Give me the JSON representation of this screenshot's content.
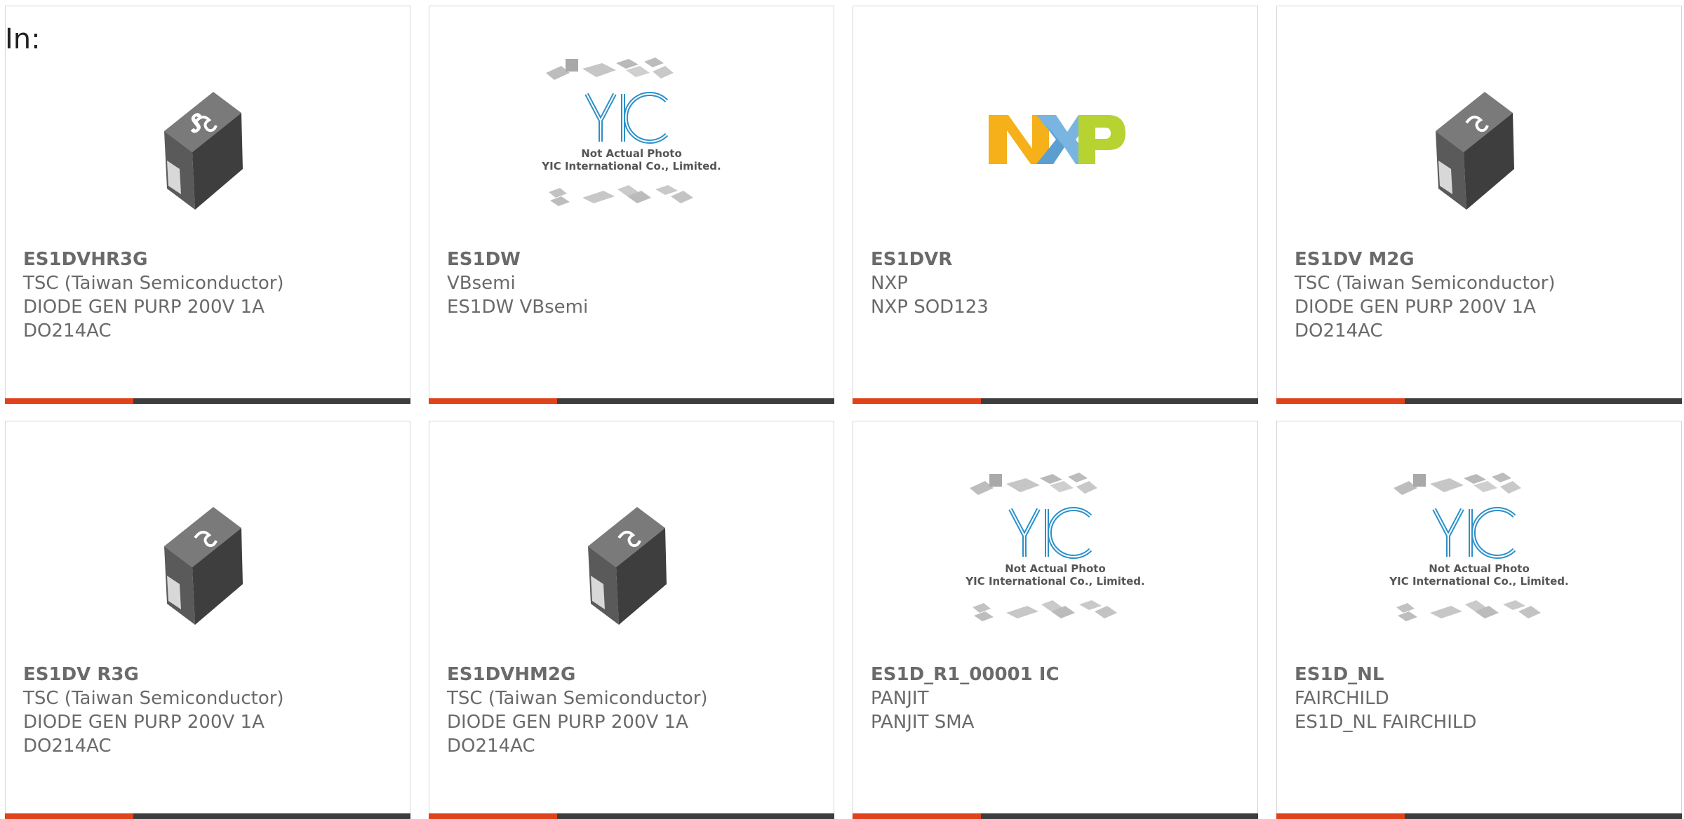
{
  "header": {
    "label": "In:"
  },
  "colors": {
    "accent": "#e0421b",
    "bar": "#3d3d3d",
    "text": "#6a6a6a",
    "border": "#d6d6d6"
  },
  "cards": [
    {
      "part": "ES1DVHR3G",
      "maker": "TSC (Taiwan Semiconductor)",
      "desc1": "DIODE GEN PURP 200V 1A",
      "desc2": "DO214AC",
      "image": "tsc-diode-package-icon"
    },
    {
      "part": "ES1DW",
      "maker": "VBsemi",
      "desc1": "ES1DW VBsemi",
      "desc2": "",
      "image": "yic-placeholder-icon",
      "placeholder_line1": "Not Actual Photo",
      "placeholder_line2": "YIC International Co., Limited."
    },
    {
      "part": "ES1DVR",
      "maker": "NXP",
      "desc1": "NXP SOD123",
      "desc2": "",
      "image": "nxp-logo"
    },
    {
      "part": "ES1DV M2G",
      "maker": "TSC (Taiwan Semiconductor)",
      "desc1": "DIODE GEN PURP 200V 1A",
      "desc2": "DO214AC",
      "image": "tsc-diode-package-icon"
    },
    {
      "part": "ES1DV R3G",
      "maker": "TSC (Taiwan Semiconductor)",
      "desc1": "DIODE GEN PURP 200V 1A",
      "desc2": "DO214AC",
      "image": "tsc-diode-package-icon"
    },
    {
      "part": "ES1DVHM2G",
      "maker": "TSC (Taiwan Semiconductor)",
      "desc1": "DIODE GEN PURP 200V 1A",
      "desc2": "DO214AC",
      "image": "tsc-diode-package-icon"
    },
    {
      "part": "ES1D_R1_00001 IC",
      "maker": "PANJIT",
      "desc1": "PANJIT SMA",
      "desc2": "",
      "image": "yic-placeholder-icon",
      "placeholder_line1": "Not Actual Photo",
      "placeholder_line2": "YIC International Co., Limited."
    },
    {
      "part": "ES1D_NL",
      "maker": "FAIRCHILD",
      "desc1": "ES1D_NL FAIRCHILD",
      "desc2": "",
      "image": "yic-placeholder-icon",
      "placeholder_line1": "Not Actual Photo",
      "placeholder_line2": "YIC International Co., Limited."
    }
  ]
}
